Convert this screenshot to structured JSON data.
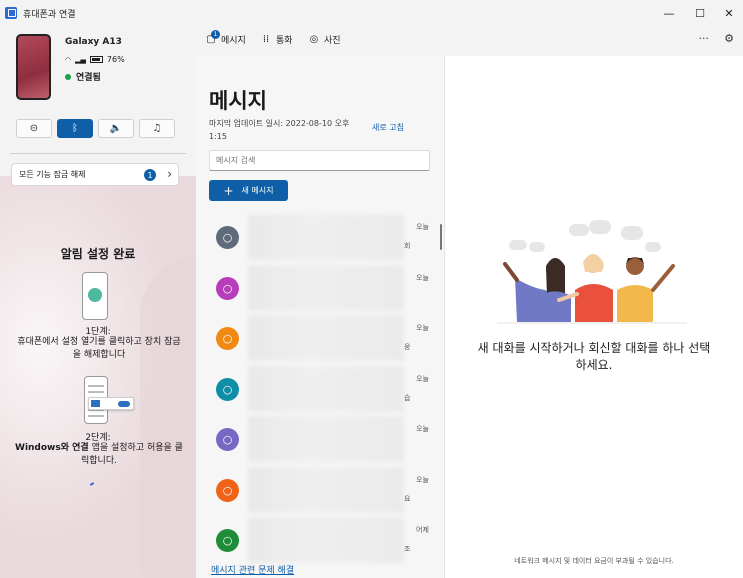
{
  "window": {
    "title": "휴대폰과 연결",
    "minimize_glyph": "—",
    "maximize_glyph": "☐",
    "close_glyph": "✕"
  },
  "device": {
    "name": "Galaxy A13",
    "battery": "76%",
    "status": "연결됨"
  },
  "quick_actions": [
    {
      "name": "do-not-disturb",
      "glyph": "⊝",
      "active": false
    },
    {
      "name": "bluetooth",
      "glyph": "ᛒ",
      "active": true
    },
    {
      "name": "sound",
      "glyph": "🔈",
      "active": false
    },
    {
      "name": "music",
      "glyph": "♫",
      "active": false
    }
  ],
  "unlock": {
    "label": "모든 기능 잠금 해제",
    "badge": "1",
    "chevron": "›"
  },
  "notification_setup": {
    "title": "알림 설정 완료",
    "step1_num": "1단계:",
    "step1_text": "휴대폰에서 설정 열기를 클릭하고 장치 잠금을 해제합니다",
    "step2_num": "2단계:",
    "step2_bold": "Windows와 연결",
    "step2_rest": " 앱을 설정하고 허용을 클릭합니다."
  },
  "nav": {
    "messages": "메시지",
    "messages_badge": "1",
    "calls": "통화",
    "photos": "사진",
    "more_glyph": "···",
    "settings_glyph": "⚙"
  },
  "messages": {
    "title": "메시지",
    "last_update": "마지막 업데이트 일시: 2022-08-10 오후 1:15",
    "refresh": "새로 고침",
    "search_placeholder": "메시지 검색",
    "new_message": "새 메시지",
    "new_message_icon": "+",
    "help_link": "메시지 관련 문제 해결",
    "conversations": [
      {
        "color": "#5f6b7a",
        "date": "오늘",
        "fragment": "회"
      },
      {
        "color": "#b83dba",
        "date": "오늘",
        "fragment": ""
      },
      {
        "color": "#f08a14",
        "date": "오늘",
        "fragment": "웅"
      },
      {
        "color": "#108ea8",
        "date": "오늘",
        "fragment": "습"
      },
      {
        "color": "#7569c4",
        "date": "오늘",
        "fragment": ""
      },
      {
        "color": "#f0641a",
        "date": "오늘",
        "fragment": "요"
      },
      {
        "color": "#1f8c3a",
        "date": "어제",
        "fragment": "조"
      }
    ]
  },
  "empty_state": {
    "text": "새 대화를 시작하거나 회신할 대화를 하나 선택하세요.",
    "footnote": "네트워크 메시지 및 데이터 요금이 부과될 수 있습니다."
  },
  "icons": {
    "person": "👤"
  }
}
